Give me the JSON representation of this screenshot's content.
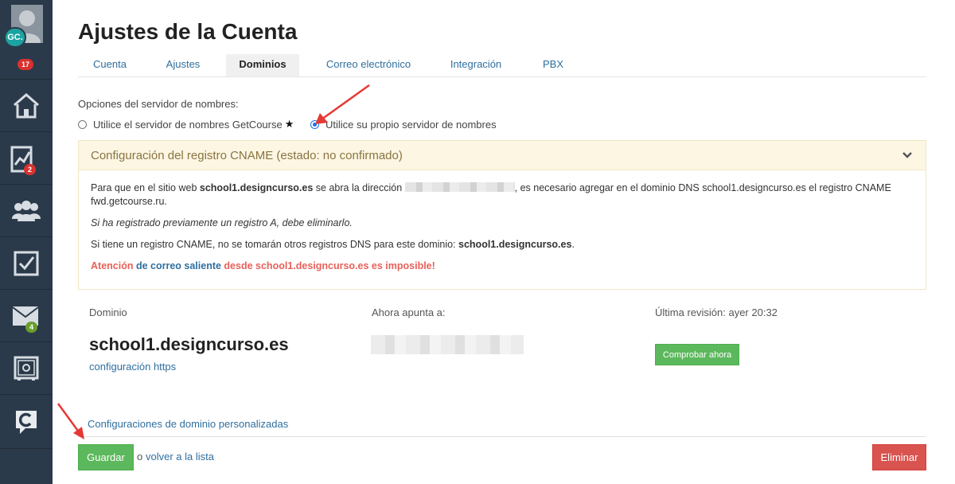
{
  "sidebar": {
    "avatar_initials": "GC.",
    "badges": {
      "notifications": "17",
      "stats": "2",
      "messages": "4"
    },
    "icons": [
      "user-avatar-icon",
      "home-icon",
      "chart-icon",
      "users-icon",
      "tasks-check-icon",
      "mail-icon",
      "safe-icon",
      "getcourse-logo-icon"
    ]
  },
  "page": {
    "title": "Ajustes de la Cuenta"
  },
  "tabs": [
    {
      "label": "Cuenta"
    },
    {
      "label": "Ajustes"
    },
    {
      "label": "Dominios"
    },
    {
      "label": "Correo electrónico"
    },
    {
      "label": "Integración"
    },
    {
      "label": "PBX"
    }
  ],
  "nameserver": {
    "label": "Opciones del servidor de nombres:",
    "option_getcourse": "Utilice el servidor de nombres GetCourse",
    "option_own": "Utilice su propio servidor de nombres",
    "selected": "own"
  },
  "cname_panel": {
    "title": "Configuración del registro CNAME (estado: no confirmado)",
    "p1_a": "Para que en el sitio web ",
    "p1_domain": "school1.designcurso.es",
    "p1_b": " se abra la dirección ",
    "p1_c": ", es necesario agregar en el dominio DNS school1.designcurso.es el registro CNAME fwd.getcourse.ru.",
    "p2": "Si ha registrado previamente un registro A, debe eliminarlo.",
    "p3_a": "Si tiene un registro CNAME, no se tomarán otros registros DNS para este dominio: ",
    "p3_domain": "school1.designcurso.es",
    "p3_b": ".",
    "warn_a": "Atención ",
    "warn_b": "de correo saliente",
    "warn_c": " desde school1.designcurso.es es imposible!"
  },
  "domain_info": {
    "col_domain": "Dominio",
    "col_points": "Ahora apunta a:",
    "col_revision": "Última revisión: ayer 20:32",
    "domain_name": "school1.designcurso.es",
    "https_link": "configuración https",
    "check_button": "Comprobar ahora"
  },
  "footer": {
    "custom_link": "Configuraciones de dominio personalizadas",
    "save_button": "Guardar",
    "or_text": "o",
    "back_link": "volver a la lista",
    "delete_button": "Eliminar"
  },
  "colors": {
    "accent_green": "#5cb85c",
    "danger_red": "#d9534f",
    "link_blue": "#2f6f9f",
    "sidebar_bg": "#2b3a4a",
    "annotation_arrow": "#e53935"
  }
}
